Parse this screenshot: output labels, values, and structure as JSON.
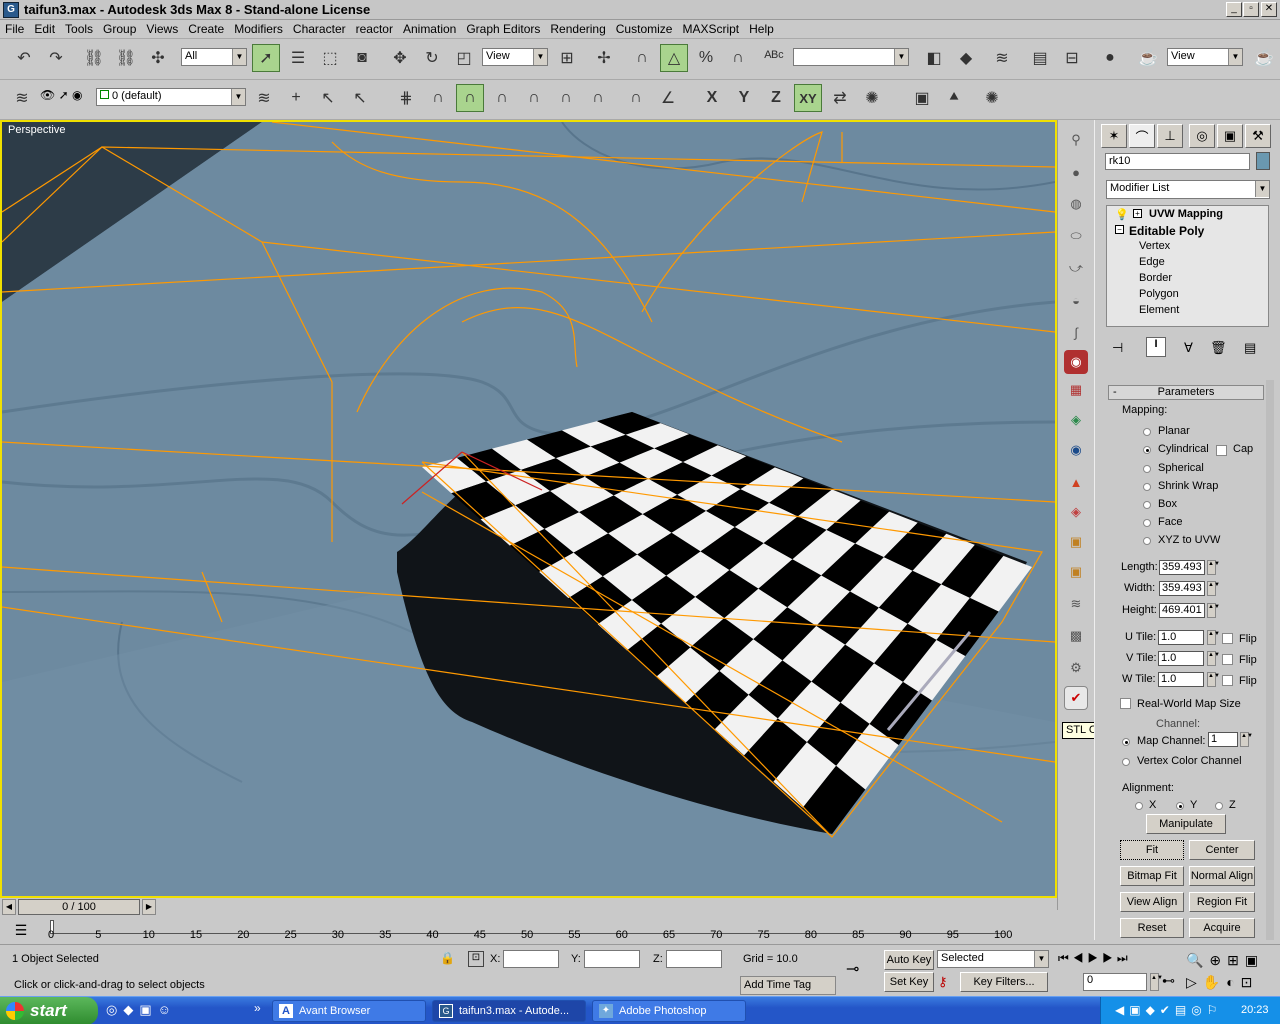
{
  "window": {
    "title": "taifun3.max - Autodesk 3ds Max 8  - Stand-alone License",
    "icon": "3dsmax-logo-icon"
  },
  "menu": [
    "File",
    "Edit",
    "Tools",
    "Group",
    "Views",
    "Create",
    "Modifiers",
    "Character",
    "reactor",
    "Animation",
    "Graph Editors",
    "Rendering",
    "Customize",
    "MAXScript",
    "Help"
  ],
  "toolbar1": {
    "selection_filter": "All",
    "ref_coord": "View",
    "named_selection": "",
    "view_dropdown2": "View"
  },
  "toolbar2": {
    "layer": "0 (default)",
    "axis_x": "X",
    "axis_y": "Y",
    "axis_z": "Z",
    "axis_xy": "XY"
  },
  "viewport": {
    "label": "Perspective"
  },
  "tooltip": "STL Check Modifier",
  "command_panel": {
    "object_name": "rk10",
    "modifier_list": "Modifier List",
    "stack": {
      "uvw": "UVW Mapping",
      "poly": "Editable Poly",
      "subs": [
        "Vertex",
        "Edge",
        "Border",
        "Polygon",
        "Element"
      ]
    },
    "rollout_title": "Parameters",
    "mapping_label": "Mapping:",
    "mapping_options": [
      "Planar",
      "Cylindrical",
      "Spherical",
      "Shrink Wrap",
      "Box",
      "Face",
      "XYZ to UVW"
    ],
    "mapping_selected": "Cylindrical",
    "cap_label": "Cap",
    "length_label": "Length:",
    "length": "359.493",
    "width_label": "Width:",
    "width": "359.493",
    "height_label": "Height:",
    "height": "469.401",
    "utile_label": "U Tile:",
    "utile": "1.0",
    "vtile_label": "V Tile:",
    "vtile": "1.0",
    "wtile_label": "W Tile:",
    "wtile": "1.0",
    "flip_label": "Flip",
    "real_world": "Real-World Map Size",
    "channel_label": "Channel:",
    "map_channel_label": "Map Channel:",
    "map_channel": "1",
    "vertex_color_channel": "Vertex Color Channel",
    "alignment_label": "Alignment:",
    "align_x": "X",
    "align_y": "Y",
    "align_z": "Z",
    "buttons": {
      "manipulate": "Manipulate",
      "fit": "Fit",
      "center": "Center",
      "bitmap_fit": "Bitmap Fit",
      "normal_align": "Normal Align",
      "view_align": "View Align",
      "region_fit": "Region Fit",
      "reset": "Reset",
      "acquire": "Acquire"
    }
  },
  "time_slider": {
    "label": "0 / 100",
    "ticks": [
      "0",
      "5",
      "10",
      "15",
      "20",
      "25",
      "30",
      "35",
      "40",
      "45",
      "50",
      "55",
      "60",
      "65",
      "70",
      "75",
      "80",
      "85",
      "90",
      "95",
      "100"
    ]
  },
  "status": {
    "selected": "1 Object Selected",
    "prompt": "Click or click-and-drag to select objects",
    "x_label": "X:",
    "y_label": "Y:",
    "z_label": "Z:",
    "grid": "Grid = 10.0",
    "add_time_tag": "Add Time Tag",
    "auto_key": "Auto Key",
    "set_key": "Set Key",
    "key_mode": "Selected",
    "key_filters": "Key Filters...",
    "frame": "0"
  },
  "taskbar": {
    "start": "start",
    "tasks": [
      {
        "label": "Avant Browser"
      },
      {
        "label": "taifun3.max - Autode..."
      },
      {
        "label": "Adobe Photoshop"
      }
    ],
    "lang": "EN",
    "clock": "20:23"
  }
}
